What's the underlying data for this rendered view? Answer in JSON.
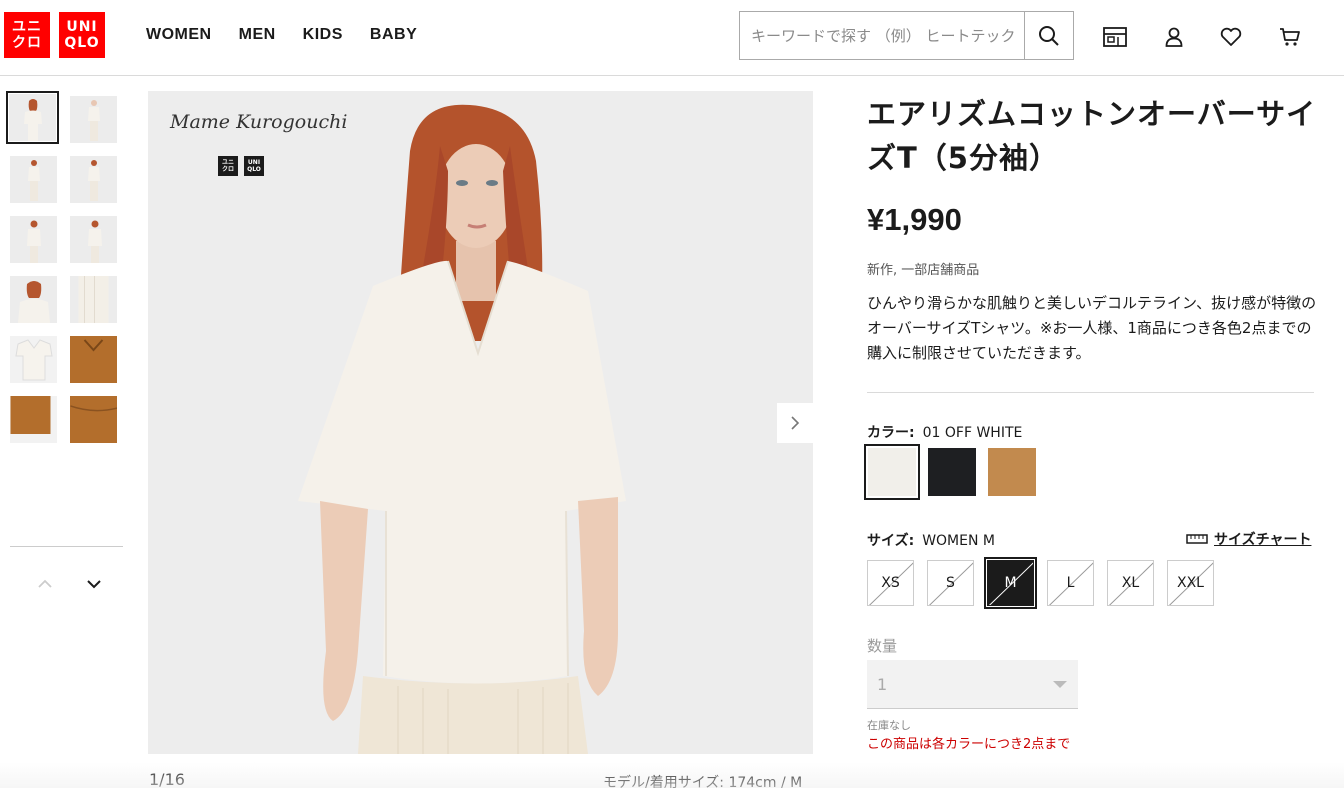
{
  "header": {
    "logo_top": "ユニ",
    "logo_bottom": "クロ",
    "logo2_top": "UNI",
    "logo2_bottom": "QLO",
    "nav": [
      "WOMEN",
      "MEN",
      "KIDS",
      "BABY"
    ],
    "search_placeholder": "キーワードで探す （例） ヒートテック",
    "icons": [
      "search-icon",
      "store-icon",
      "account-icon",
      "heart-icon",
      "cart-icon"
    ]
  },
  "gallery": {
    "collab_mark": "Mame Kurogouchi",
    "counter": "1/16",
    "model_size": "モデル/着用サイズ: 174cm / M"
  },
  "product": {
    "title": "エアリズムコットンオーバーサイズT（5分袖）",
    "price": "¥1,990",
    "flags": "新作, 一部店舗商品",
    "description": "ひんやり滑らかな肌触りと美しいデコルテライン、抜け感が特徴のオーバーサイズTシャツ。※お一人様、1商品につき各色2点までの購入に制限させていただきます。",
    "color_label": "カラー:",
    "color_value": "01 OFF WHITE",
    "colors": [
      {
        "name": "off-white",
        "hex": "#f1efea",
        "selected": true
      },
      {
        "name": "black",
        "hex": "#1e1f22",
        "selected": false
      },
      {
        "name": "brown",
        "hex": "#c28a4e",
        "selected": false
      }
    ],
    "size_label": "サイズ:",
    "size_value": "WOMEN M",
    "size_chart": "サイズチャート",
    "sizes": [
      "XS",
      "S",
      "M",
      "L",
      "XL",
      "XXL"
    ],
    "selected_size": "M",
    "quantity_label": "数量",
    "quantity_value": "1",
    "stock_status": "在庫なし",
    "limit_note": "この商品は各カラーにつき2点まで"
  },
  "colors": {
    "brand_red": "#ff0000",
    "limit_red": "#cc0000"
  }
}
